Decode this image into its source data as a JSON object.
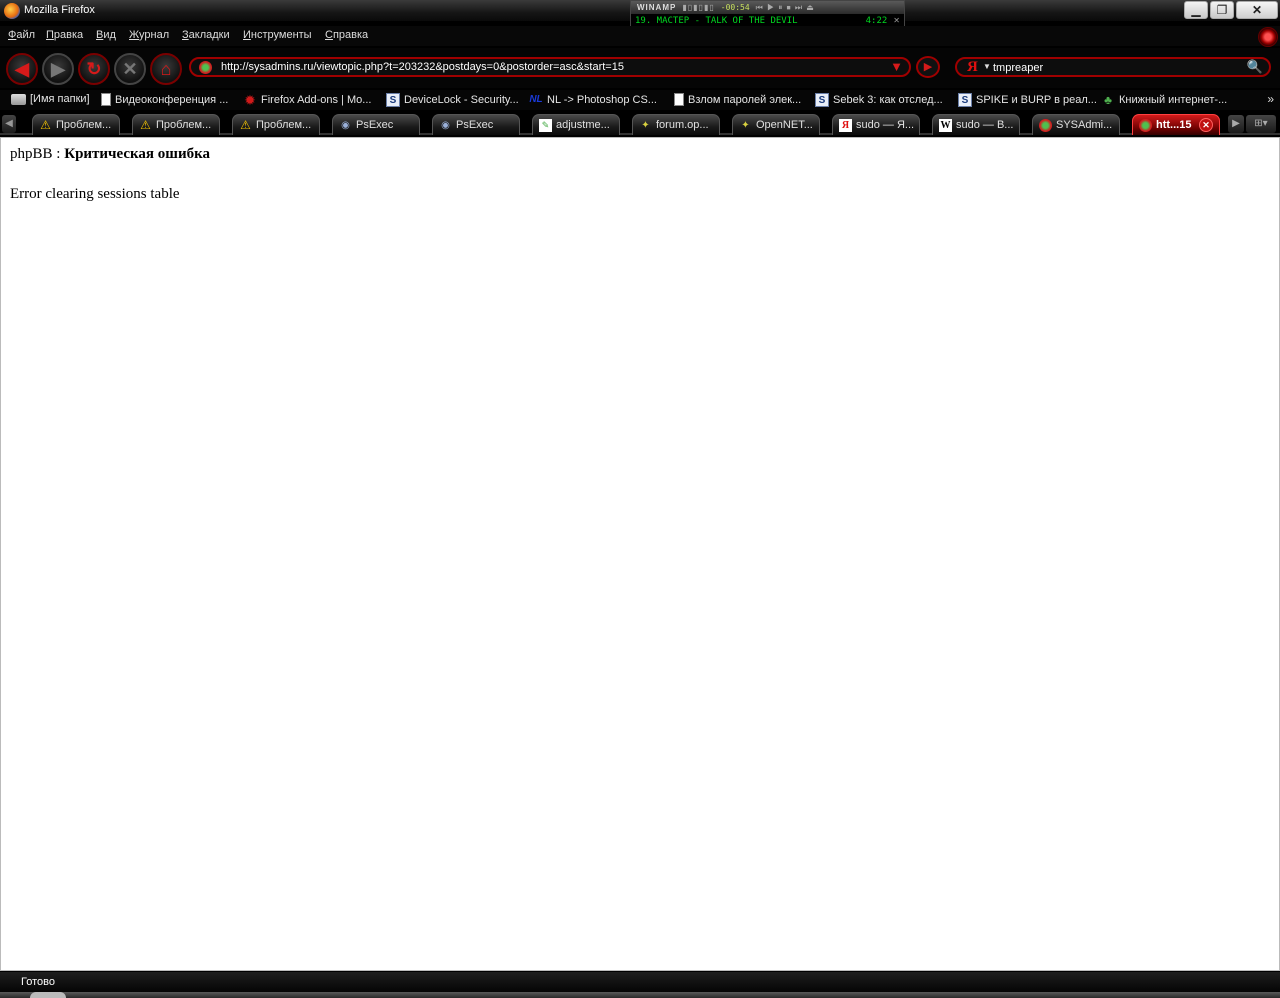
{
  "window": {
    "title": "Mozilla Firefox",
    "minimize": "▁",
    "maximize": "❐",
    "close": "✕"
  },
  "winamp": {
    "logo": "WINAMP",
    "time": "-00:54",
    "track": "19. МАСТЕР - TALK OF THE DEVIL",
    "duration": "4:22"
  },
  "menu": {
    "items": [
      {
        "accel": "Ф",
        "rest": "айл"
      },
      {
        "accel": "П",
        "rest": "равка"
      },
      {
        "accel": "В",
        "rest": "ид"
      },
      {
        "accel": "Ж",
        "rest": "урнал"
      },
      {
        "accel": "З",
        "rest": "акладки"
      },
      {
        "accel": "И",
        "rest": "нструменты"
      },
      {
        "accel": "С",
        "rest": "правка"
      }
    ]
  },
  "nav": {
    "back": "◀",
    "forward": "▶",
    "reload": "↻",
    "stop": "✕",
    "home": "⌂",
    "url": "http://sysadmins.ru/viewtopic.php?t=203232&postdays=0&postorder=asc&start=15",
    "url_dropdown": "▼",
    "go": "▶",
    "search_engine": "Я",
    "search_value": "tmpreaper"
  },
  "bookmarks": {
    "items": [
      {
        "icon": "folder-icon",
        "label": "[Имя папки]"
      },
      {
        "icon": "page-icon",
        "label": "Видеоконференция ..."
      },
      {
        "icon": "addons-icon",
        "label": "Firefox Add-ons | Mo..."
      },
      {
        "icon": "sysadmins-icon",
        "label": "DeviceLock - Security..."
      },
      {
        "icon": "nl-icon",
        "label": "NL -> Photoshop CS..."
      },
      {
        "icon": "page-icon",
        "label": "Взлом паролей элек..."
      },
      {
        "icon": "sysadmins-icon",
        "label": "Sebek 3: как отслед..."
      },
      {
        "icon": "sysadmins-icon",
        "label": "SPIKE и BURP в реал..."
      },
      {
        "icon": "book-icon",
        "label": "Книжный интернет-..."
      }
    ],
    "more": "»"
  },
  "tabs": {
    "items": [
      {
        "icon": "warning-icon",
        "label": "Проблем..."
      },
      {
        "icon": "warning-icon",
        "label": "Проблем..."
      },
      {
        "icon": "warning-icon",
        "label": "Проблем..."
      },
      {
        "icon": "psexec-icon",
        "label": "PsExec"
      },
      {
        "icon": "psexec-icon",
        "label": "PsExec"
      },
      {
        "icon": "adjust-icon",
        "label": "adjustme..."
      },
      {
        "icon": "star-icon",
        "label": "forum.op..."
      },
      {
        "icon": "star-icon",
        "label": "OpenNET..."
      },
      {
        "icon": "yandex-icon",
        "label": "sudo — Я..."
      },
      {
        "icon": "wikipedia-icon",
        "label": "sudo — В..."
      },
      {
        "icon": "sysadmins-icon",
        "label": "SYSAdmi..."
      },
      {
        "icon": "sysadmins-icon",
        "label": "htt...15"
      }
    ],
    "active_index": 11
  },
  "content": {
    "prefix": "phpBB : ",
    "title": "Критическая ошибка",
    "message": "Error clearing sessions table"
  },
  "status": {
    "text": "Готово"
  }
}
